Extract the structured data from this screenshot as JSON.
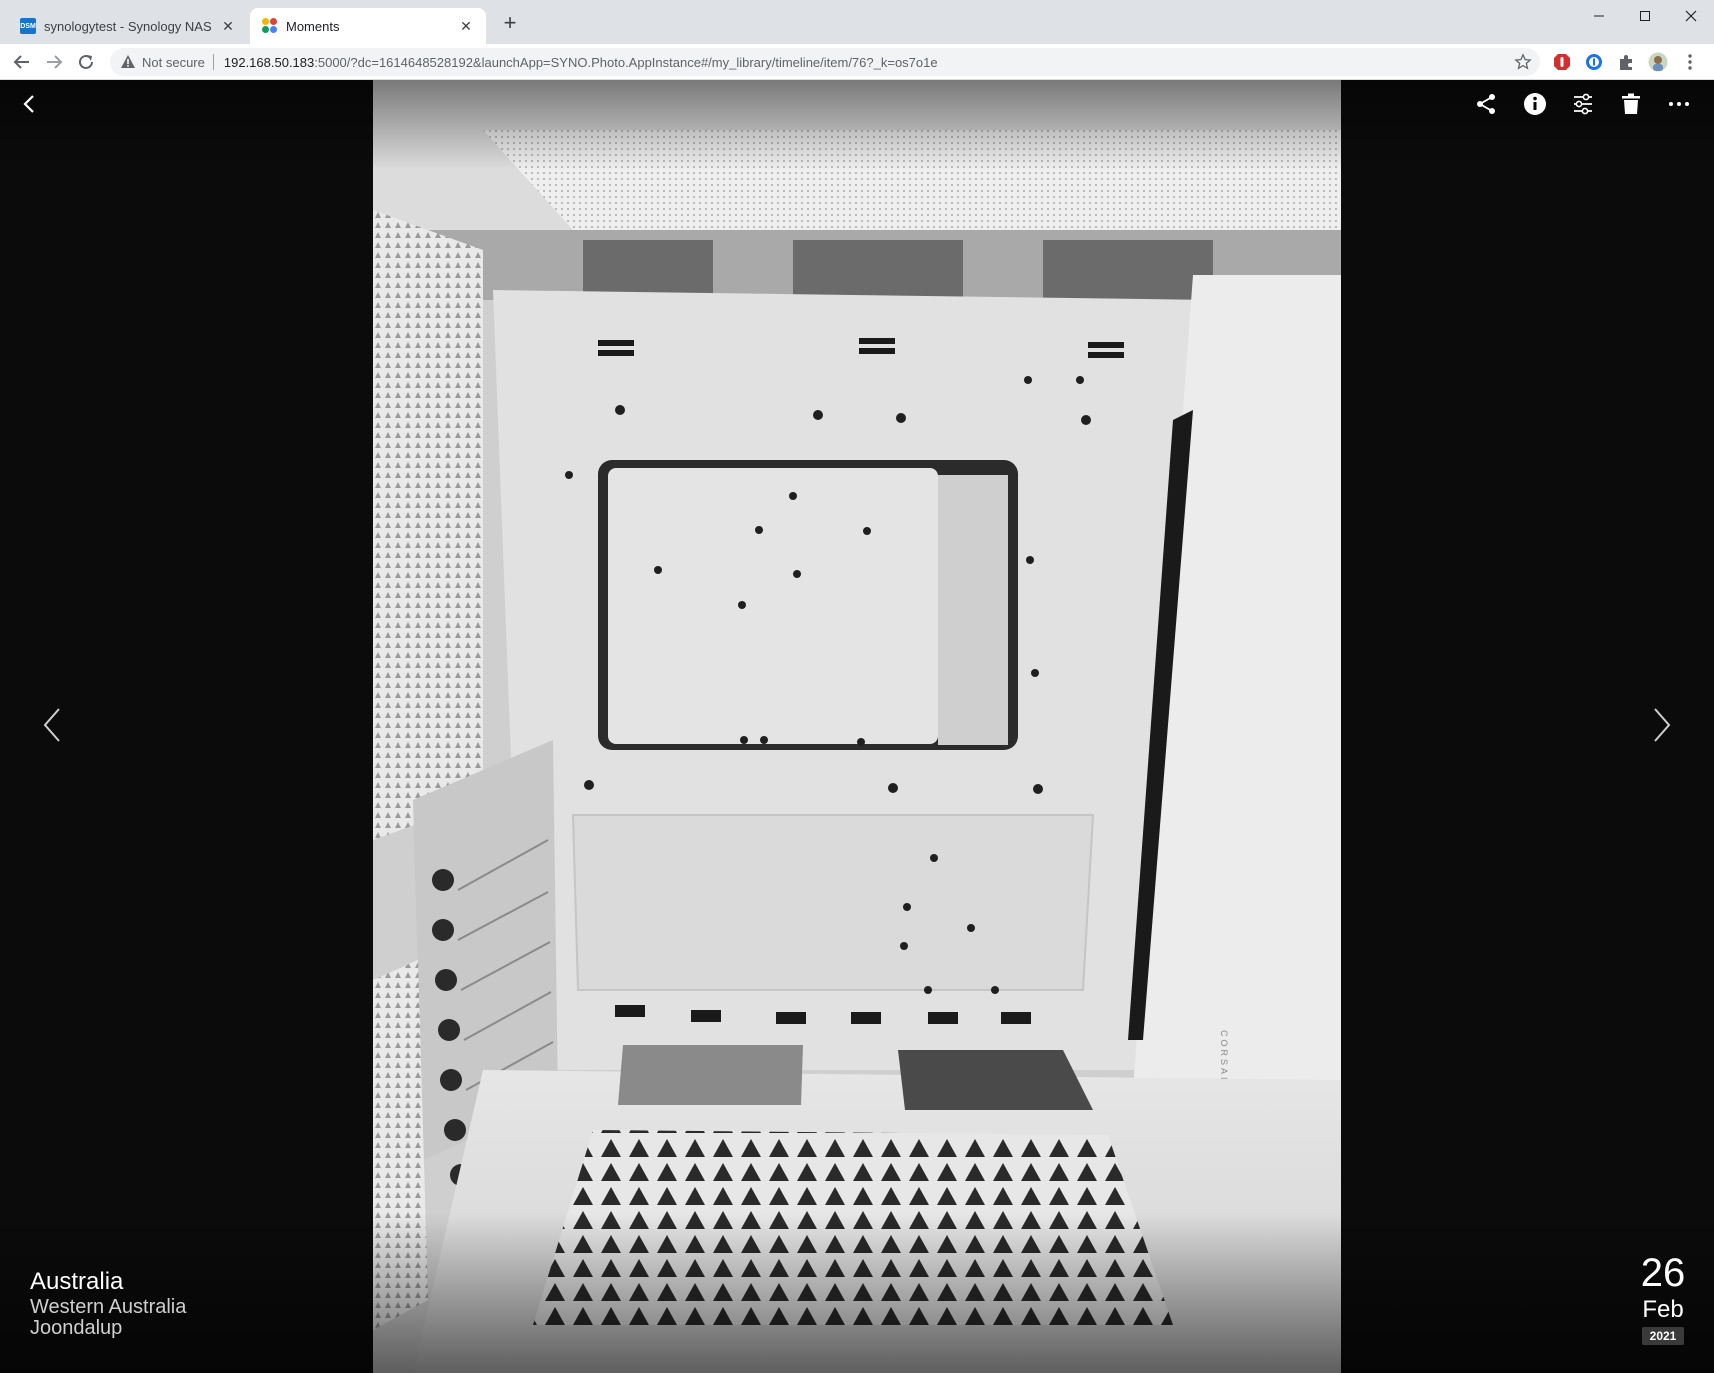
{
  "browser": {
    "tabs": [
      {
        "title": "synologytest - Synology NAS",
        "favicon": "dsm-icon",
        "favicon_text": "DSM",
        "active": false
      },
      {
        "title": "Moments",
        "favicon": "moments-icon",
        "active": true
      }
    ],
    "newtab_label": "+",
    "window_controls": [
      "minimize-icon",
      "maximize-icon",
      "close-icon"
    ],
    "address": {
      "security_label": "Not secure",
      "host": "192.168.50.183",
      "path": ":5000/?dc=1614648528192&launchApp=SYNO.Photo.AppInstance#/my_library/timeline/item/76?_k=os7o1e"
    },
    "extensions": [
      "adblock-icon",
      "password-manager-icon",
      "puzzle-icon",
      "profile-avatar"
    ],
    "menu_icon": "kebab-menu-icon"
  },
  "viewer": {
    "back_icon": "chevron-left-icon",
    "actions": [
      "share-icon",
      "info-icon",
      "adjust-icon",
      "trash-icon",
      "more-icon"
    ],
    "prev_icon": "chevron-left-icon",
    "next_icon": "chevron-right-icon",
    "photo_description_icon": "photo",
    "photo_brand_text": "CORSAIR",
    "location": {
      "country": "Australia",
      "state": "Western Australia",
      "city": "Joondalup"
    },
    "date": {
      "day": "26",
      "month": "Feb",
      "year": "2021"
    }
  }
}
